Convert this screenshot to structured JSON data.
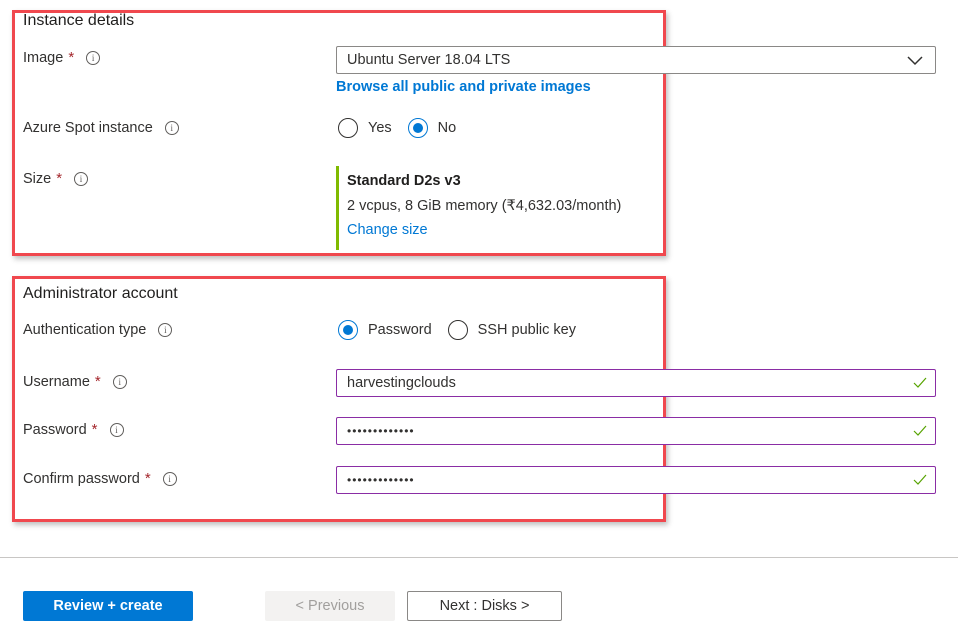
{
  "instance_details": {
    "title": "Instance details",
    "image": {
      "label": "Image",
      "required_marker": "*",
      "info_icon": "i",
      "selected": "Ubuntu Server 18.04 LTS",
      "browse_link": "Browse all public and private images"
    },
    "spot": {
      "label": "Azure Spot instance",
      "info_icon": "i",
      "options": [
        {
          "label": "Yes",
          "checked": false
        },
        {
          "label": "No",
          "checked": true
        }
      ]
    },
    "size": {
      "label": "Size",
      "required_marker": "*",
      "info_icon": "i",
      "name": "Standard D2s v3",
      "description": "2 vcpus, 8 GiB memory (₹4,632.03/month)",
      "change_link": "Change size"
    }
  },
  "admin_account": {
    "title": "Administrator account",
    "auth_type": {
      "label": "Authentication type",
      "info_icon": "i",
      "options": [
        {
          "label": "Password",
          "checked": true
        },
        {
          "label": "SSH public key",
          "checked": false
        }
      ]
    },
    "username": {
      "label": "Username",
      "required_marker": "*",
      "info_icon": "i",
      "value": "harvestingclouds"
    },
    "password": {
      "label": "Password",
      "required_marker": "*",
      "info_icon": "i",
      "value": "•••••••••••••"
    },
    "confirm_password": {
      "label": "Confirm password",
      "required_marker": "*",
      "info_icon": "i",
      "value": "•••••••••••••"
    }
  },
  "footer": {
    "review_create": "Review + create",
    "previous": "< Previous",
    "next": "Next : Disks >"
  },
  "colors": {
    "accent": "#0078d4",
    "highlight": "#f0484e",
    "valid": "#57a300",
    "size_bar": "#7fba00",
    "input_border": "#8a2da5"
  }
}
